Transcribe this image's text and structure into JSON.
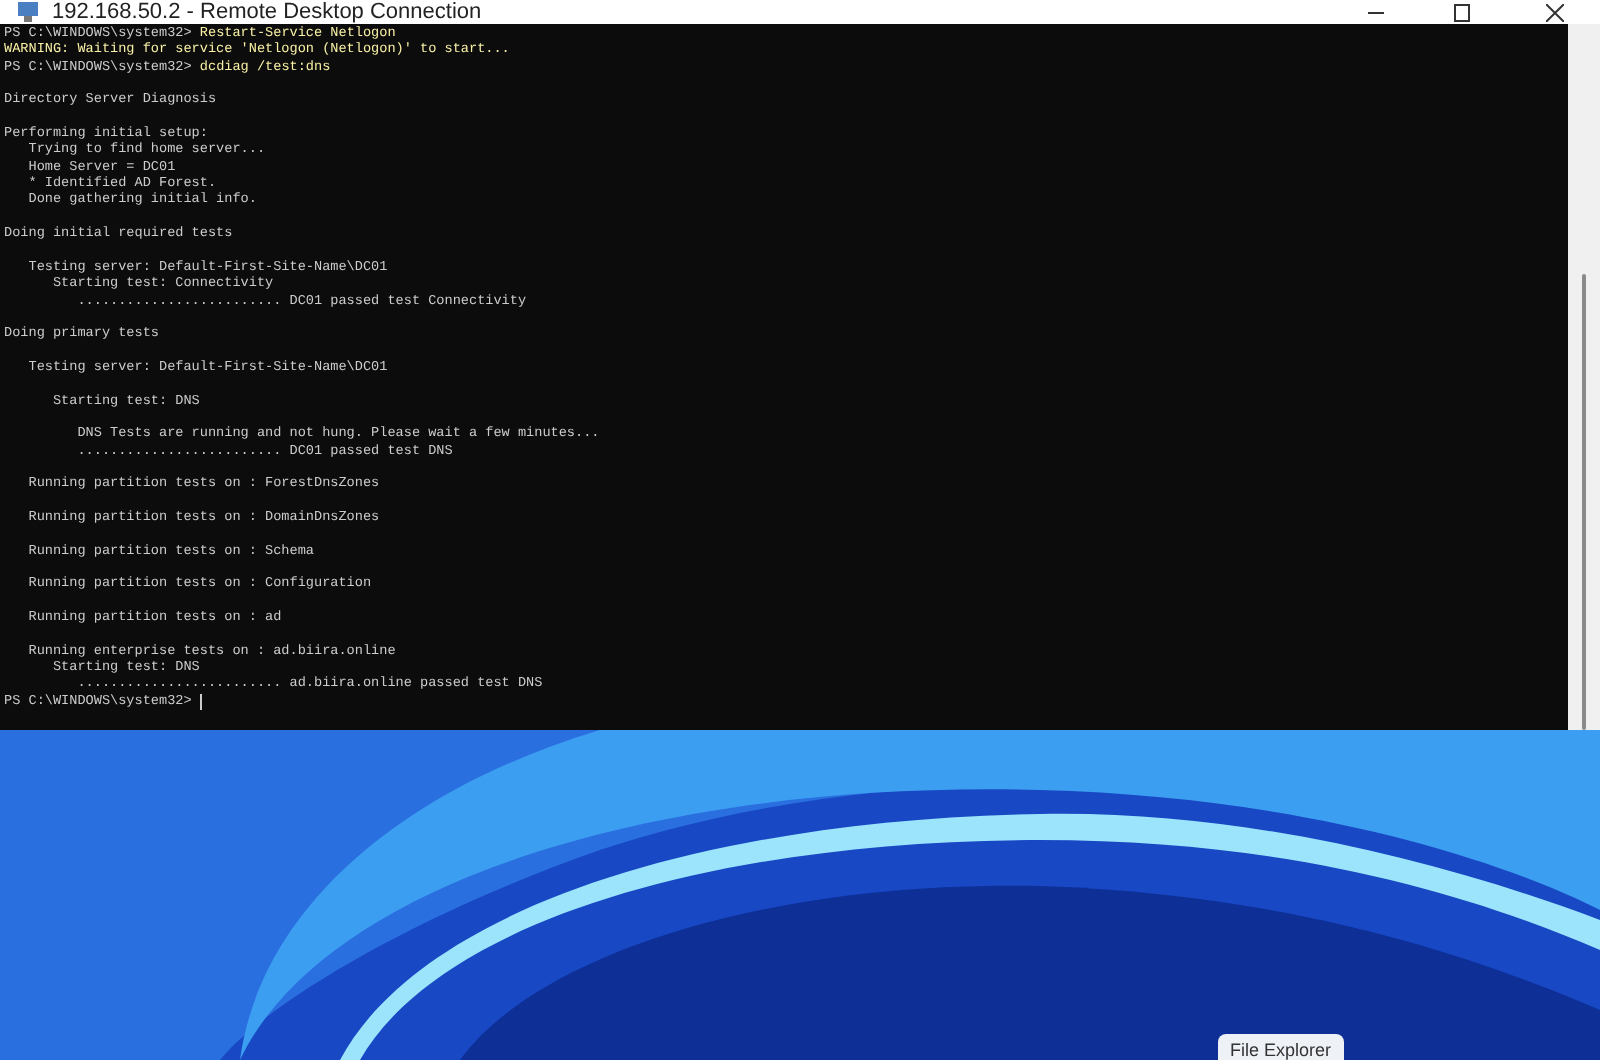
{
  "window": {
    "title": "192.168.50.2 - Remote Desktop Connection"
  },
  "terminal": {
    "lines": [
      {
        "kind": "prompt",
        "prompt": "PS C:\\WINDOWS\\system32> ",
        "command": "Restart-Service Netlogon"
      },
      {
        "kind": "warning",
        "text": "WARNING: Waiting for service 'Netlogon (Netlogon)' to start..."
      },
      {
        "kind": "prompt",
        "prompt": "PS C:\\WINDOWS\\system32> ",
        "command": "dcdiag /test:dns"
      },
      {
        "kind": "blank"
      },
      {
        "kind": "output",
        "text": "Directory Server Diagnosis"
      },
      {
        "kind": "blank"
      },
      {
        "kind": "output",
        "text": "Performing initial setup:"
      },
      {
        "kind": "output",
        "text": "   Trying to find home server..."
      },
      {
        "kind": "output",
        "text": "   Home Server = DC01"
      },
      {
        "kind": "output",
        "text": "   * Identified AD Forest."
      },
      {
        "kind": "output",
        "text": "   Done gathering initial info."
      },
      {
        "kind": "blank"
      },
      {
        "kind": "output",
        "text": "Doing initial required tests"
      },
      {
        "kind": "blank"
      },
      {
        "kind": "output",
        "text": "   Testing server: Default-First-Site-Name\\DC01"
      },
      {
        "kind": "output",
        "text": "      Starting test: Connectivity"
      },
      {
        "kind": "output",
        "text": "         ......................... DC01 passed test Connectivity"
      },
      {
        "kind": "blank"
      },
      {
        "kind": "output",
        "text": "Doing primary tests"
      },
      {
        "kind": "blank"
      },
      {
        "kind": "output",
        "text": "   Testing server: Default-First-Site-Name\\DC01"
      },
      {
        "kind": "blank"
      },
      {
        "kind": "output",
        "text": "      Starting test: DNS"
      },
      {
        "kind": "blank"
      },
      {
        "kind": "output",
        "text": "         DNS Tests are running and not hung. Please wait a few minutes..."
      },
      {
        "kind": "output",
        "text": "         ......................... DC01 passed test DNS"
      },
      {
        "kind": "blank"
      },
      {
        "kind": "output",
        "text": "   Running partition tests on : ForestDnsZones"
      },
      {
        "kind": "blank"
      },
      {
        "kind": "output",
        "text": "   Running partition tests on : DomainDnsZones"
      },
      {
        "kind": "blank"
      },
      {
        "kind": "output",
        "text": "   Running partition tests on : Schema"
      },
      {
        "kind": "blank"
      },
      {
        "kind": "output",
        "text": "   Running partition tests on : Configuration"
      },
      {
        "kind": "blank"
      },
      {
        "kind": "output",
        "text": "   Running partition tests on : ad"
      },
      {
        "kind": "blank"
      },
      {
        "kind": "output",
        "text": "   Running enterprise tests on : ad.biira.online"
      },
      {
        "kind": "output",
        "text": "      Starting test: DNS"
      },
      {
        "kind": "output",
        "text": "         ......................... ad.biira.online passed test DNS"
      },
      {
        "kind": "prompt",
        "prompt": "PS C:\\WINDOWS\\system32> ",
        "cursor": true
      }
    ]
  },
  "tooltip": {
    "text": "File Explorer"
  }
}
